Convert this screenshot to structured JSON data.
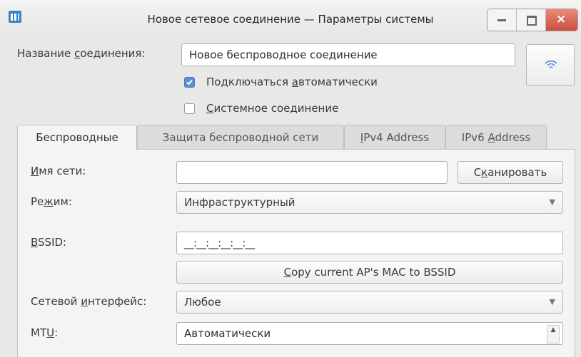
{
  "window": {
    "title": "Новое сетевое соединение — Параметры системы",
    "buttons": {
      "minimize": "minimize",
      "maximize": "maximize",
      "close": "×"
    }
  },
  "connection": {
    "name_label_pre": "Название ",
    "name_label_u": "с",
    "name_label_post": "оединения:",
    "name_value": "Новое беспроводное соединение",
    "auto_connect_pre": "Подключаться ",
    "auto_connect_u": "а",
    "auto_connect_post": "втоматически",
    "auto_connect_checked": true,
    "system_conn_u": "С",
    "system_conn_post": "истемное соединение",
    "system_conn_checked": false
  },
  "tabs": [
    {
      "pre": "Беспроводные",
      "u": "",
      "post": "",
      "active": true
    },
    {
      "pre": "Защита беспроводной сети",
      "u": "",
      "post": "",
      "active": false
    },
    {
      "pre": "",
      "u": "I",
      "post": "Pv4 Address",
      "active": false
    },
    {
      "pre": "IPv6 ",
      "u": "A",
      "post": "ddress",
      "active": false
    }
  ],
  "wireless": {
    "ssid_label_u": "И",
    "ssid_label_post": "мя сети:",
    "ssid_value": "",
    "scan_pre": "С",
    "scan_u": "к",
    "scan_post": "анировать",
    "mode_label_pre": "Ре",
    "mode_label_u": "ж",
    "mode_label_post": "им:",
    "mode_value": "Инфраструктурный",
    "bssid_label_u": "B",
    "bssid_label_post": "SSID:",
    "bssid_value": "__:__:__:__:__:__",
    "copy_mac_u": "C",
    "copy_mac_post": "opy current AP's MAC to BSSID",
    "iface_label_pre": "Сетевой ",
    "iface_label_u": "и",
    "iface_label_post": "нтерфейс:",
    "iface_value": "Любое",
    "mtu_label_pre": "MT",
    "mtu_label_u": "U",
    "mtu_label_post": ":",
    "mtu_value": "Автоматически"
  },
  "colors": {
    "accent": "#5b8fd6",
    "close": "#d2604b"
  }
}
